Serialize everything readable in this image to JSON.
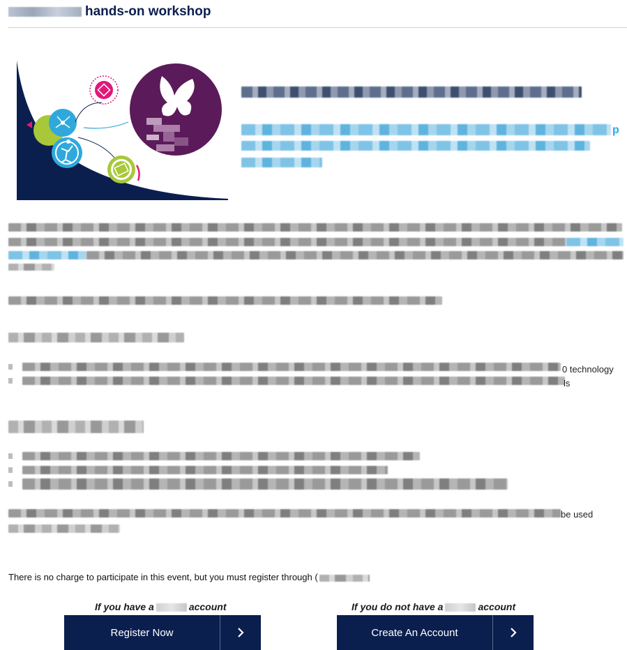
{
  "header": {
    "title": "hands-on workshop"
  },
  "body_fragments": {
    "tech_suffix": "0 technology",
    "tech_suffix2": "ls",
    "used_suffix": "be used"
  },
  "info": {
    "charge_text": "There is no charge to participate in this event, but you must register through ("
  },
  "register": {
    "have_account_prefix": "If you have a",
    "have_account_suffix": "account",
    "no_account_prefix": "If you do not have a",
    "no_account_suffix": "account",
    "register_button": "Register Now",
    "create_button": "Create An Account"
  },
  "colors": {
    "navy": "#0b1f4f",
    "accent_blue": "#2fa8dc",
    "purple": "#5b1a5a",
    "lime": "#a8c83a",
    "magenta": "#e0187a"
  }
}
